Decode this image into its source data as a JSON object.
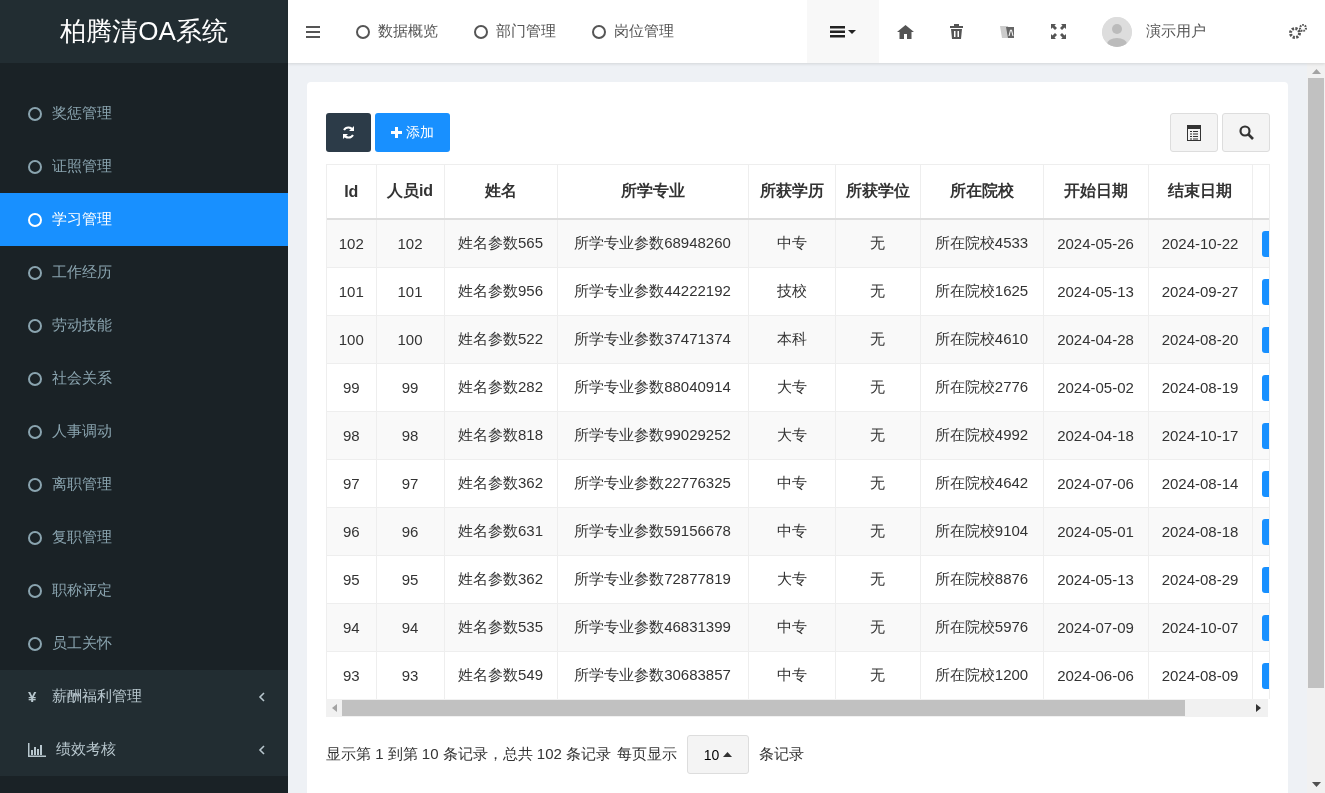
{
  "app_title": "柏腾清OA系统",
  "top_tabs": [
    {
      "label": "数据概览"
    },
    {
      "label": "部门管理"
    },
    {
      "label": "岗位管理"
    }
  ],
  "user": {
    "name": "演示用户"
  },
  "sidebar": {
    "items": [
      {
        "label": "奖惩管理",
        "selected": false,
        "kind": "leaf"
      },
      {
        "label": "证照管理",
        "selected": false,
        "kind": "leaf"
      },
      {
        "label": "学习管理",
        "selected": true,
        "kind": "leaf"
      },
      {
        "label": "工作经历",
        "selected": false,
        "kind": "leaf"
      },
      {
        "label": "劳动技能",
        "selected": false,
        "kind": "leaf"
      },
      {
        "label": "社会关系",
        "selected": false,
        "kind": "leaf"
      },
      {
        "label": "人事调动",
        "selected": false,
        "kind": "leaf"
      },
      {
        "label": "离职管理",
        "selected": false,
        "kind": "leaf"
      },
      {
        "label": "复职管理",
        "selected": false,
        "kind": "leaf"
      },
      {
        "label": "职称评定",
        "selected": false,
        "kind": "leaf"
      },
      {
        "label": "员工关怀",
        "selected": false,
        "kind": "leaf"
      },
      {
        "label": "薪酬福利管理",
        "kind": "money",
        "icon_text": "¥",
        "expanded": false
      },
      {
        "label": "绩效考核",
        "kind": "chart",
        "expanded": false
      }
    ]
  },
  "toolbar": {
    "add_label": "添加"
  },
  "table": {
    "columns": [
      "Id",
      "人员id",
      "姓名",
      "所学专业",
      "所获学历",
      "所获学位",
      "所在院校",
      "开始日期",
      "结束日期"
    ],
    "rows": [
      [
        "102",
        "102",
        "姓名参数565",
        "所学专业参数68948260",
        "中专",
        "无",
        "所在院校4533",
        "2024-05-26",
        "2024-10-22"
      ],
      [
        "101",
        "101",
        "姓名参数956",
        "所学专业参数44222192",
        "技校",
        "无",
        "所在院校1625",
        "2024-05-13",
        "2024-09-27"
      ],
      [
        "100",
        "100",
        "姓名参数522",
        "所学专业参数37471374",
        "本科",
        "无",
        "所在院校4610",
        "2024-04-28",
        "2024-08-20"
      ],
      [
        "99",
        "99",
        "姓名参数282",
        "所学专业参数88040914",
        "大专",
        "无",
        "所在院校2776",
        "2024-05-02",
        "2024-08-19"
      ],
      [
        "98",
        "98",
        "姓名参数818",
        "所学专业参数99029252",
        "大专",
        "无",
        "所在院校4992",
        "2024-04-18",
        "2024-10-17"
      ],
      [
        "97",
        "97",
        "姓名参数362",
        "所学专业参数22776325",
        "中专",
        "无",
        "所在院校4642",
        "2024-07-06",
        "2024-08-14"
      ],
      [
        "96",
        "96",
        "姓名参数631",
        "所学专业参数59156678",
        "中专",
        "无",
        "所在院校9104",
        "2024-05-01",
        "2024-08-18"
      ],
      [
        "95",
        "95",
        "姓名参数362",
        "所学专业参数72877819",
        "大专",
        "无",
        "所在院校8876",
        "2024-05-13",
        "2024-08-29"
      ],
      [
        "94",
        "94",
        "姓名参数535",
        "所学专业参数46831399",
        "中专",
        "无",
        "所在院校5976",
        "2024-07-09",
        "2024-10-07"
      ],
      [
        "93",
        "93",
        "姓名参数549",
        "所学专业参数30683857",
        "中专",
        "无",
        "所在院校1200",
        "2024-06-06",
        "2024-08-09"
      ]
    ]
  },
  "pagination": {
    "summary": "显示第 1 到第 10 条记录，总共 102 条记录",
    "per_page_label": "每页显示",
    "page_size": "10",
    "suffix": "条记录"
  }
}
